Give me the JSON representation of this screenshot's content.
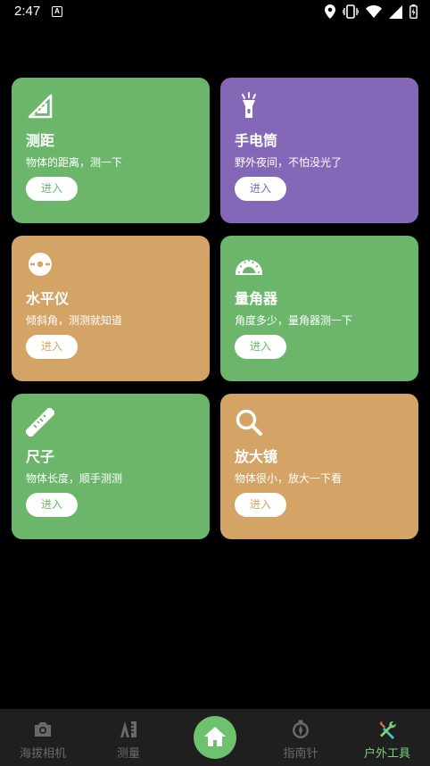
{
  "status": {
    "time": "2:47"
  },
  "cards": [
    {
      "title": "测距",
      "desc": "物体的距离，测一下",
      "button": "进入",
      "color": "#6bb66b",
      "icon": "ruler-triangle-icon"
    },
    {
      "title": "手电筒",
      "desc": "野外夜间，不怕没光了",
      "button": "进入",
      "color": "#8467b7",
      "icon": "flashlight-icon"
    },
    {
      "title": "水平仪",
      "desc": "倾斜角，测测就知道",
      "button": "进入",
      "color": "#d4a466",
      "icon": "level-icon"
    },
    {
      "title": "量角器",
      "desc": "角度多少，量角器测一下",
      "button": "进入",
      "color": "#6bb66b",
      "icon": "protractor-icon"
    },
    {
      "title": "尺子",
      "desc": "物体长度，顺手测测",
      "button": "进入",
      "color": "#6bb66b",
      "icon": "ruler-icon"
    },
    {
      "title": "放大镜",
      "desc": "物体很小，放大一下看",
      "button": "进入",
      "color": "#d4a466",
      "icon": "magnifier-icon"
    }
  ],
  "tabs": [
    {
      "label": "海拔相机",
      "icon": "camera-icon",
      "active": false
    },
    {
      "label": "测量",
      "icon": "measure-icon",
      "active": false
    },
    {
      "label": "指南针",
      "icon": "compass-icon",
      "active": false
    },
    {
      "label": "户外工具",
      "icon": "tools-icon",
      "active": true
    }
  ],
  "home": {
    "icon": "home-icon"
  },
  "colors": {
    "active_tab": "#7bd07a",
    "home": "#6ec26e"
  }
}
